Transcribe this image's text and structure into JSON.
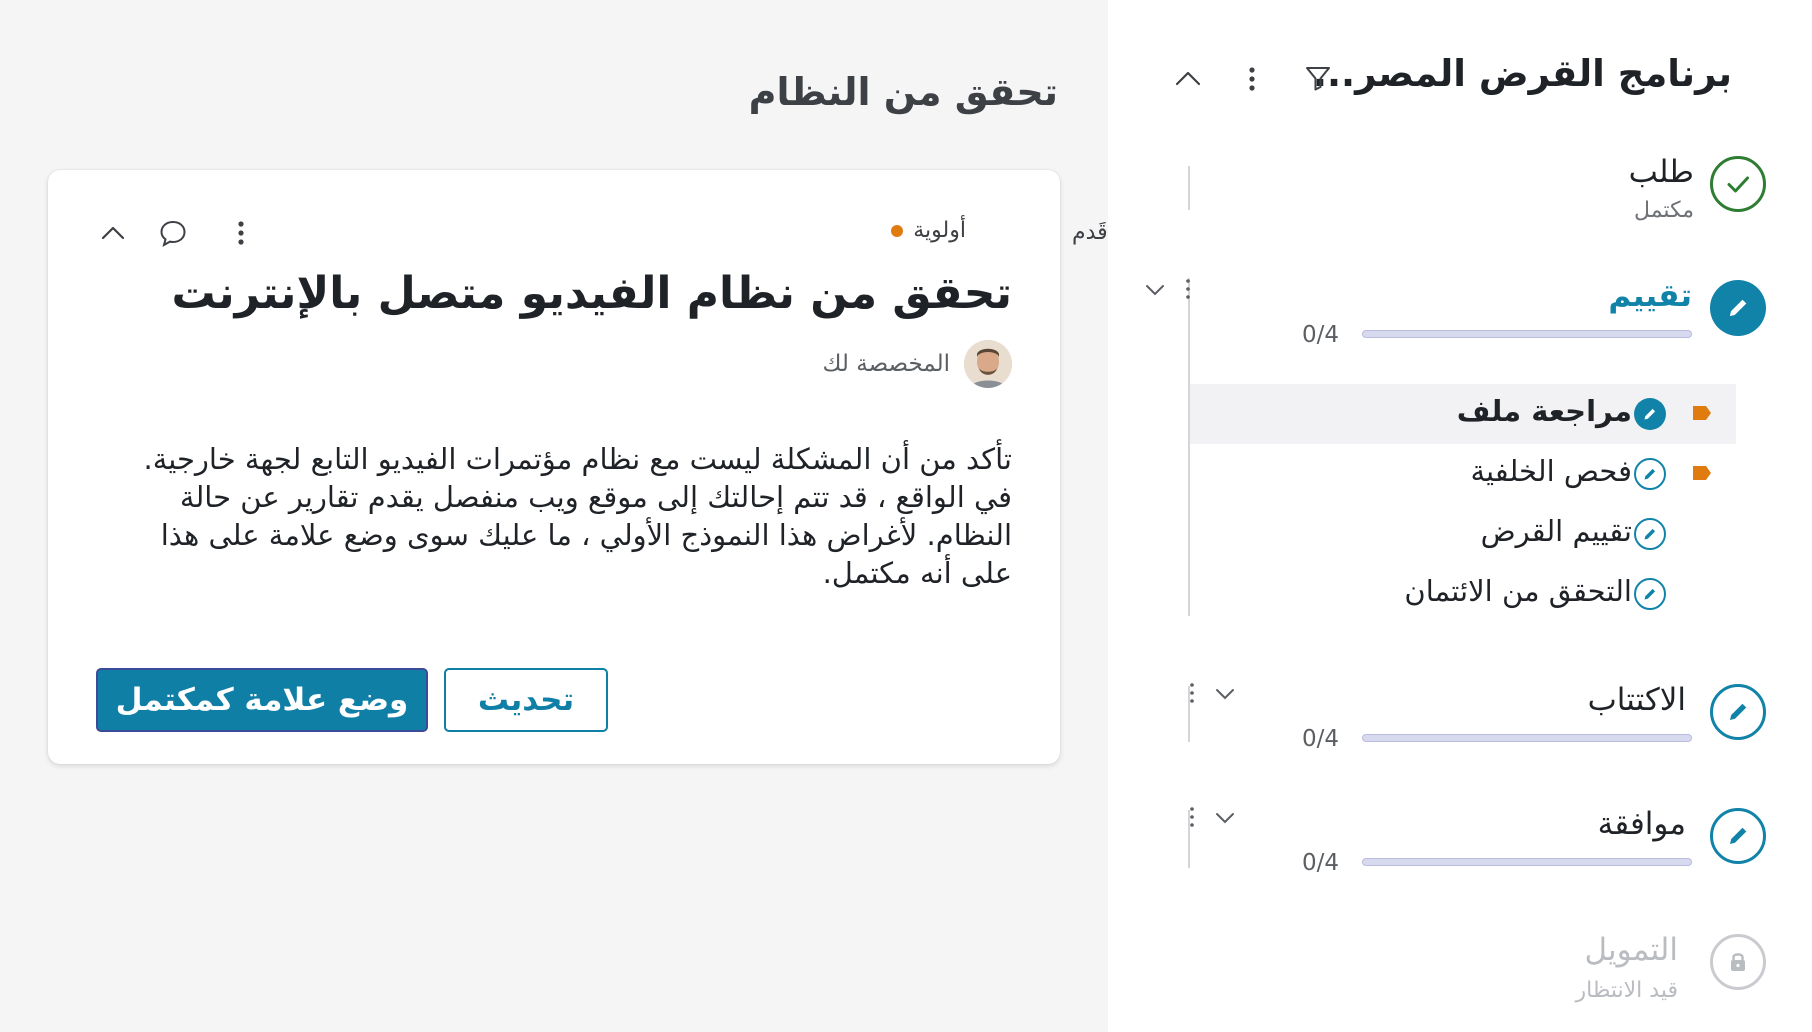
{
  "page": {
    "title": "تحقق من النظام",
    "clipped_label": "قَدم"
  },
  "task_card": {
    "priority": {
      "label": "أولوية",
      "color": "#e07b10"
    },
    "title": "تحقق من نظام الفيديو متصل بالإنترنت",
    "assignee_label": "المخصصة لك",
    "body": "تأكد من أن المشكلة ليست مع نظام مؤتمرات الفيديو التابع لجهة خارجية. في الواقع ، قد تتم إحالتك إلى موقع ويب منفصل يقدم تقارير عن حالة النظام. لأغراض هذا النموذج الأولي ، ما عليك سوى وضع علامة على هذا على أنه مكتمل.",
    "primary_button": "وضع علامة كمكتمل",
    "secondary_button": "تحديث",
    "icons": [
      "more-vertical-icon",
      "comment-icon",
      "chevron-up-icon"
    ]
  },
  "stage_panel": {
    "title": "برنامج القرض المصر...",
    "icons": [
      "filter-icon",
      "more-vertical-icon",
      "chevron-up-icon"
    ],
    "stages": [
      {
        "name": "طلب",
        "status": "مكتمل",
        "state": "done"
      },
      {
        "name": "تقييم",
        "progress": "0/4",
        "state": "active",
        "steps": [
          {
            "label": "مراجعة ملف",
            "flag": true,
            "selected": true
          },
          {
            "label": "فحص الخلفية",
            "flag": true,
            "selected": false
          },
          {
            "label": "تقييم القرض",
            "flag": false,
            "selected": false
          },
          {
            "label": "التحقق من الائتمان",
            "flag": false,
            "selected": false
          }
        ]
      },
      {
        "name": "الاكتتاب",
        "progress": "0/4",
        "state": "pending"
      },
      {
        "name": "موافقة",
        "progress": "0/4",
        "state": "pending"
      },
      {
        "name": "التمويل",
        "status": "قيد الانتظار",
        "state": "locked"
      }
    ],
    "colors": {
      "accent": "#1283a8",
      "done": "#2f7d32",
      "flag": "#e07b10",
      "locked": "#b9bcc0"
    }
  }
}
